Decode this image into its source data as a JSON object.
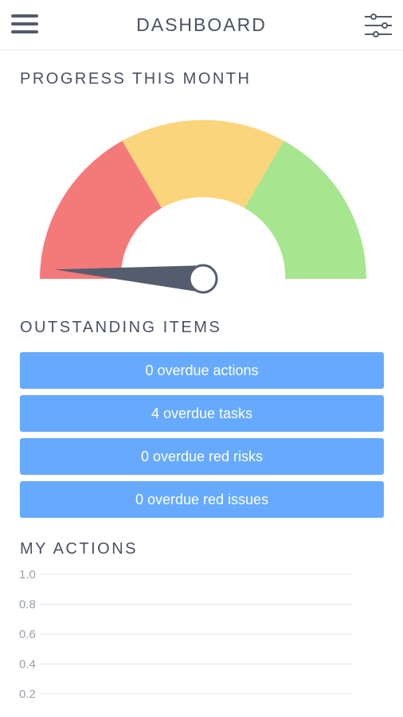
{
  "header": {
    "title": "DASHBOARD",
    "menu_icon": "hamburger-menu-icon",
    "filter_icon": "sliders-icon"
  },
  "progress": {
    "title": "PROGRESS THIS MONTH",
    "gauge": {
      "value": 0.02,
      "segments": [
        {
          "name": "low",
          "color": "#f47a7a"
        },
        {
          "name": "medium",
          "color": "#fad57b"
        },
        {
          "name": "high",
          "color": "#a6e68e"
        }
      ],
      "needle_color": "#545d6d"
    }
  },
  "outstanding": {
    "title": "OUTSTANDING ITEMS",
    "items": [
      {
        "label": "0 overdue actions"
      },
      {
        "label": "4 overdue tasks"
      },
      {
        "label": "0 overdue red risks"
      },
      {
        "label": "0 overdue red issues"
      }
    ],
    "button_color": "#66aaff"
  },
  "my_actions": {
    "title": "MY ACTIONS"
  },
  "chart_data": {
    "type": "bar",
    "categories": [],
    "values": [],
    "title": "",
    "xlabel": "",
    "ylabel": "",
    "ylim": [
      0,
      1
    ],
    "yticks": [
      "1.0",
      "0.8",
      "0.6",
      "0.4",
      "0.2"
    ],
    "grid": true
  }
}
